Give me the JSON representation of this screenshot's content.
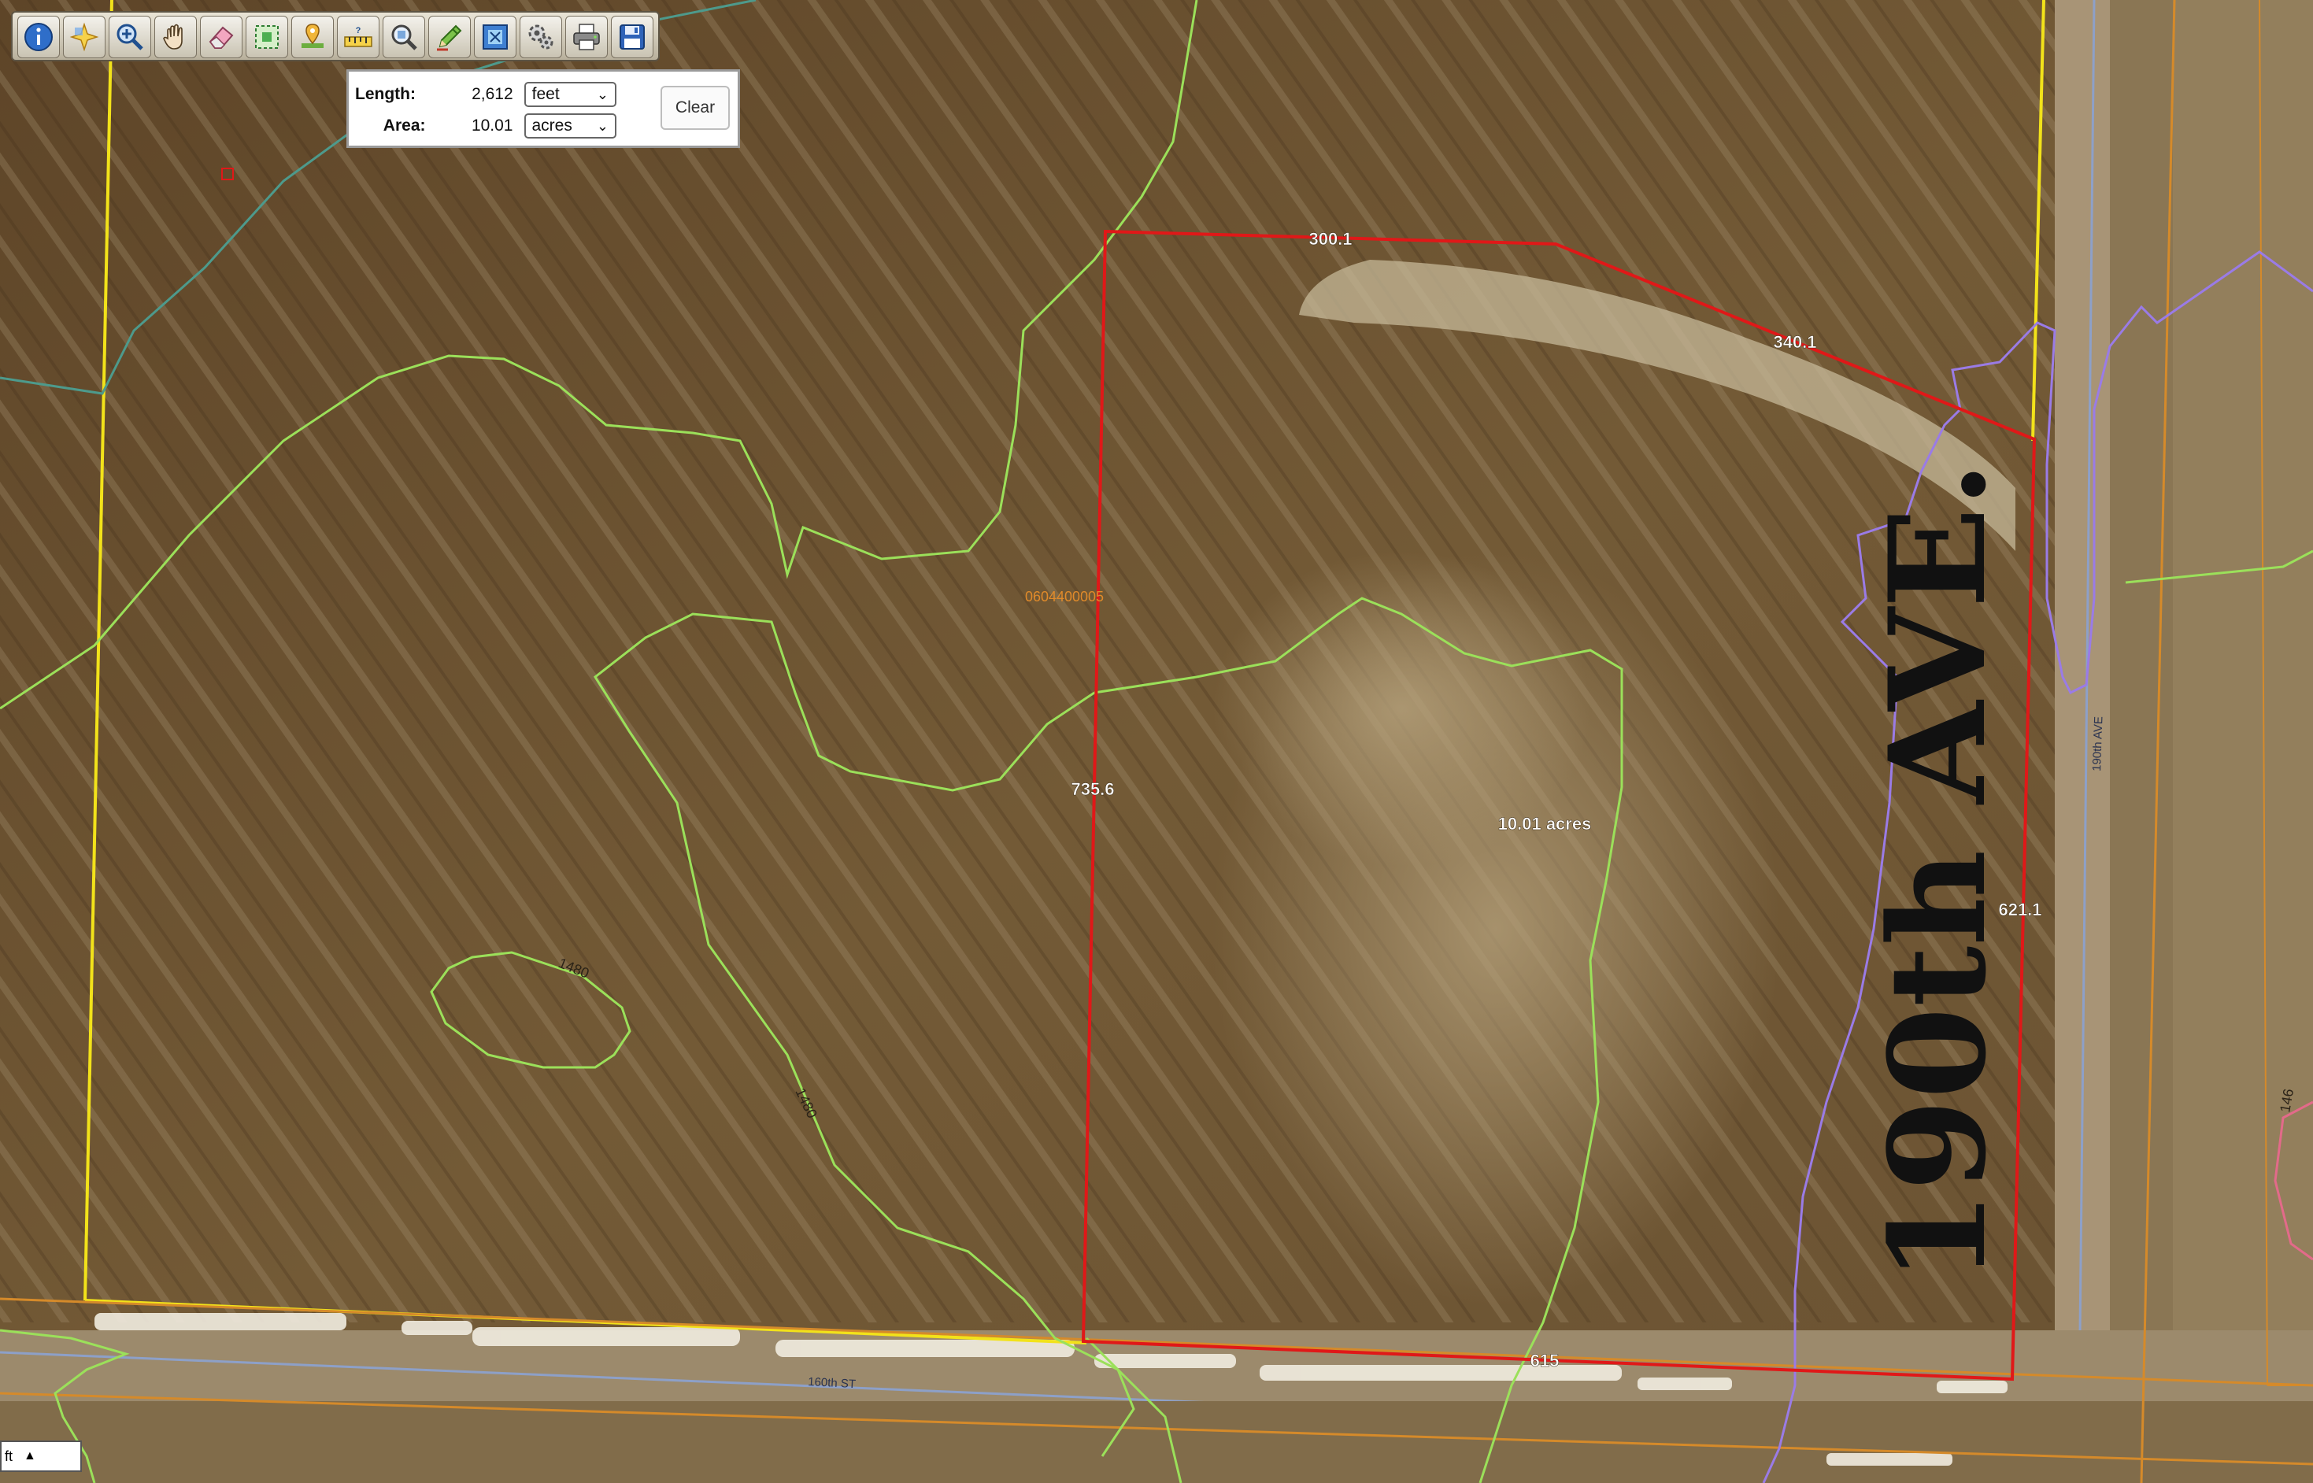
{
  "toolbar": {
    "tools": [
      {
        "name": "identify-icon"
      },
      {
        "name": "select-icon"
      },
      {
        "name": "zoom-in-icon"
      },
      {
        "name": "pan-hand-icon"
      },
      {
        "name": "eraser-icon"
      },
      {
        "name": "select-box-icon"
      },
      {
        "name": "location-icon"
      },
      {
        "name": "measure-icon"
      },
      {
        "name": "search-icon"
      },
      {
        "name": "draw-pencil-icon"
      },
      {
        "name": "full-extent-icon"
      },
      {
        "name": "settings-icon"
      },
      {
        "name": "print-icon"
      },
      {
        "name": "save-icon"
      }
    ]
  },
  "measure": {
    "length_label": "Length:",
    "length_value": "2,612",
    "length_unit": "feet",
    "area_label": "Area:",
    "area_value": "10.01",
    "area_unit": "acres",
    "clear_label": "Clear"
  },
  "map": {
    "dimensions": {
      "top": "300.1",
      "top_right": "340.1",
      "left": "735.6",
      "right": "621.1",
      "bottom": "615"
    },
    "area_label": "10.01 acres",
    "parcel_id": "0604400005",
    "contour_a": "1480",
    "contour_b": "1480",
    "contour_c": "146",
    "road_label_big": "190th AVE.",
    "road_label_small": "190th AVE",
    "street_label": "160th ST"
  },
  "scale": {
    "unit": "ft"
  },
  "colors": {
    "parcel_outline": "#e01818",
    "section_line": "#f2e21a",
    "contour": "#9be05a",
    "creek": "#9a7be6",
    "parcel_line": "#d58a2a"
  }
}
